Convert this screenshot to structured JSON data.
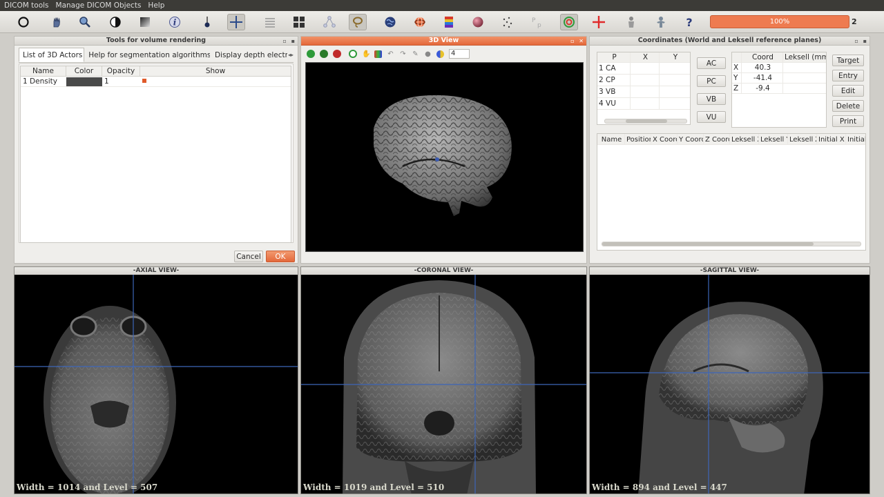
{
  "menubar": [
    "DICOM tools",
    "Manage DICOM Objects",
    "Help"
  ],
  "toolbar": {
    "progress_label": "100%",
    "counter": "2",
    "icons": [
      "circle-icon",
      "hand-icon",
      "magnifier-icon",
      "contrast-icon",
      "window-level-icon",
      "info-icon",
      "pin-icon",
      "crosshair-icon",
      "list-icon",
      "grid-icon",
      "network-icon",
      "lasso-icon",
      "globe-icon",
      "rings-icon",
      "palette-icon",
      "sphere-icon",
      "points-icon",
      "point-label-icon",
      "target-icon",
      "plus-icon",
      "skeleton-icon",
      "person-icon",
      "help-icon"
    ]
  },
  "tools_panel": {
    "title": "Tools for volume rendering",
    "tabs": [
      "List of 3D Actors",
      "Help for segmentation algorithms",
      "Display depth electro"
    ],
    "columns": [
      "Name",
      "Color",
      "Opacity",
      "Show"
    ],
    "rows": [
      {
        "index": "1",
        "name": "Density",
        "opacity": "1",
        "color": "#4a4a4a"
      }
    ],
    "cancel_label": "Cancel",
    "ok_label": "OK"
  },
  "view3d": {
    "title": "3D View",
    "zoom_value": "4",
    "background": "#000000"
  },
  "coords_panel": {
    "title": "Coordinates (World and Leksell reference planes)",
    "points_columns": [
      "P",
      "X",
      "Y"
    ],
    "points": [
      {
        "index": "1",
        "name": "CA"
      },
      {
        "index": "2",
        "name": "CP"
      },
      {
        "index": "3",
        "name": "VB"
      },
      {
        "index": "4",
        "name": "VU"
      }
    ],
    "point_buttons": [
      "AC",
      "PC",
      "VB",
      "VU"
    ],
    "coord_columns": [
      "Coord",
      "Leksell (mm"
    ],
    "coords": [
      {
        "axis": "X",
        "value": "40.3"
      },
      {
        "axis": "Y",
        "value": "-41.4"
      },
      {
        "axis": "Z",
        "value": "-9.4"
      }
    ],
    "action_buttons": [
      "Target",
      "Entry",
      "Edit",
      "Delete",
      "Print"
    ],
    "targets_columns": [
      "Name",
      "Position",
      "X Coord",
      "Y Coord",
      "Z Coord",
      "Leksell X",
      "Leksell Y",
      "Leksell Z",
      "Initial X",
      "Initial Y"
    ]
  },
  "mri_views": [
    {
      "title": "-AXIAL VIEW-",
      "width_level": "Width = 1014 and Level =  507"
    },
    {
      "title": "-CORONAL VIEW-",
      "width_level": "Width = 1019 and Level =  510"
    },
    {
      "title": "-SAGITTAL VIEW-",
      "width_level": "Width = 894 and Level =  447"
    }
  ],
  "colors": {
    "accent": "#e86f41",
    "crosshair": "#3d66b8",
    "viewport": "#000000"
  }
}
